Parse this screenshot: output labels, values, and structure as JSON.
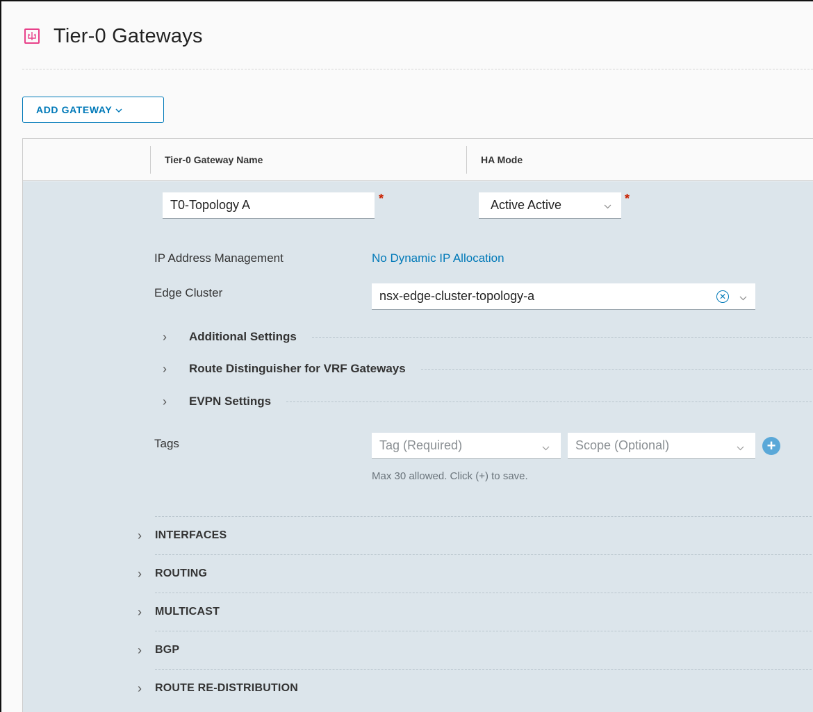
{
  "page": {
    "title": "Tier-0 Gateways",
    "icon": "tier0-gateway-icon"
  },
  "toolbar": {
    "add_gateway_label": "ADD GATEWAY",
    "add_gateway_caret": "⌄"
  },
  "table": {
    "columns": [
      "Tier-0 Gateway Name",
      "HA Mode"
    ]
  },
  "form": {
    "name_value": "T0-Topology A",
    "required_marker": "*",
    "ha_mode_value": "Active Active",
    "ip_management_label": "IP Address Management",
    "ip_management_value": "No Dynamic IP Allocation",
    "edge_cluster_label": "Edge Cluster",
    "edge_cluster_value": "nsx-edge-cluster-topology-a",
    "sections": [
      "Additional Settings",
      "Route Distinguisher for VRF Gateways",
      "EVPN Settings"
    ],
    "tags_label": "Tags",
    "tag_placeholder": "Tag (Required)",
    "scope_placeholder": "Scope (Optional)",
    "tags_hint": "Max 30 allowed. Click (+) to save."
  },
  "expandable_rows": [
    "INTERFACES",
    "ROUTING",
    "MULTICAST",
    "BGP",
    "ROUTE RE-DISTRIBUTION"
  ],
  "colors": {
    "accent": "#0079b8",
    "brand_pink": "#e8418a",
    "required": "#c92100",
    "row_bg": "#dce5eb"
  }
}
